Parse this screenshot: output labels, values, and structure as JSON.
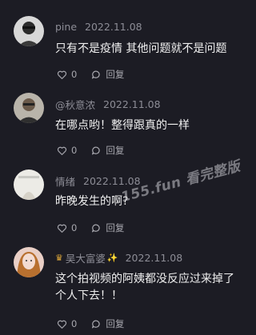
{
  "comments": [
    {
      "name": "pine",
      "date": "2022.11.08",
      "text": "只有不是疫情 其他问题就不是问题",
      "likes": "0",
      "reply_label": "回复"
    },
    {
      "name": "@秋意浓",
      "date": "2022.11.08",
      "text": "在哪点哟！整得跟真的一样",
      "likes": "0",
      "reply_label": "回复"
    },
    {
      "name": "情绪",
      "date": "2022.11.08",
      "text": "昨晚发生的啊?",
      "likes": "0",
      "reply_label": "回复"
    },
    {
      "name": "吴大富婆",
      "date": "2022.11.08",
      "text": "这个拍视频的阿姨都没反应过来掉了个人下去！！",
      "likes": "0",
      "reply_label": "回复",
      "name_prefix_icon": "crown-icon",
      "name_suffix_icon": "sparkle-icon"
    }
  ],
  "watermark": "155.fun 看完整版",
  "colors": {
    "background": "#1c1c24",
    "meta": "#8d8d96",
    "text": "#efefef",
    "action": "#a7a7ae"
  }
}
